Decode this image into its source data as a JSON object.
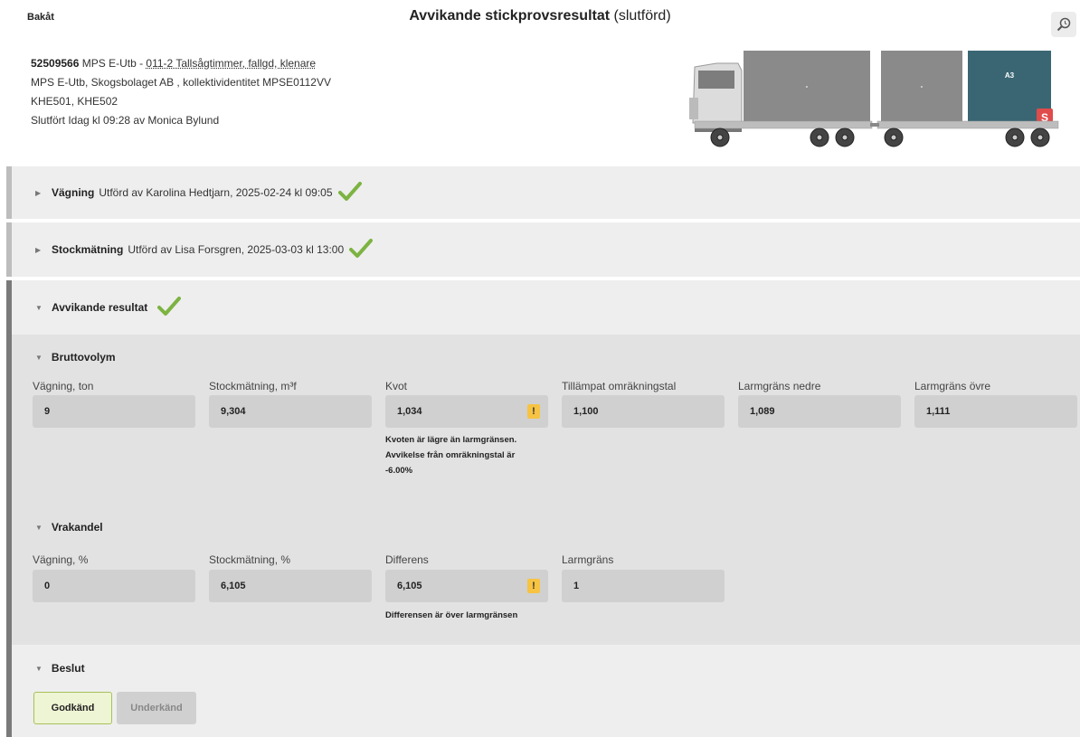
{
  "header": {
    "back_label": "Bakåt",
    "title": "Avvikande stickprovsresultat",
    "status": "(slutförd)"
  },
  "info": {
    "id": "52509566",
    "id_rest": " MPS E-Utb - ",
    "assortment": "011-2 Tallsågtimmer, fallgd, klenare",
    "line2": "MPS E-Utb, Skogsbolaget AB , kollektividentitet MPSE0112VV",
    "line3": "KHE501, KHE502",
    "line4": "Slutfört Idag kl 09:28 av Monica Bylund"
  },
  "truck": {
    "compartments": [
      "-",
      "-",
      "A3"
    ],
    "badge": "S",
    "colors": {
      "grey": "#8a8a8a",
      "active": "#3a6674",
      "badge": "#e04b4b"
    }
  },
  "sections": {
    "weighing": {
      "name": "Vägning",
      "sub": "Utförd av Karolina Hedtjarn, 2025-02-24 kl 09:05"
    },
    "log_measuring": {
      "name": "Stockmätning",
      "sub": "Utförd av Lisa Forsgren, 2025-03-03 kl 13:00"
    },
    "deviating": {
      "name": "Avvikande resultat"
    }
  },
  "gross_volume": {
    "title": "Bruttovolym",
    "fields": [
      {
        "label": "Vägning, ton",
        "value": "9"
      },
      {
        "label": "Stockmätning, m³f",
        "value": "9,304"
      },
      {
        "label": "Kvot",
        "value": "1,034"
      },
      {
        "label": "Tillämpat omräkningstal",
        "value": "1,100"
      },
      {
        "label": "Larmgräns nedre",
        "value": "1,089"
      },
      {
        "label": "Larmgräns övre",
        "value": "1,111"
      }
    ],
    "note_lines": [
      "Kvoten är lägre än larmgränsen.",
      "Avvikelse från omräkningstal är",
      "-6.00%"
    ]
  },
  "reject_share": {
    "title": "Vrakandel",
    "fields": [
      {
        "label": "Vägning, %",
        "value": "0"
      },
      {
        "label": "Stockmätning, %",
        "value": "6,105"
      },
      {
        "label": "Differens",
        "value": "6,105"
      },
      {
        "label": "Larmgräns",
        "value": "1"
      }
    ],
    "note": "Differensen är över larmgränsen"
  },
  "decision": {
    "title": "Beslut",
    "approve_label": "Godkänd",
    "reject_label": "Underkänd"
  },
  "colors": {
    "check": "#7cb342",
    "warn": "#f6c343",
    "approve_border": "#a6c15a"
  }
}
